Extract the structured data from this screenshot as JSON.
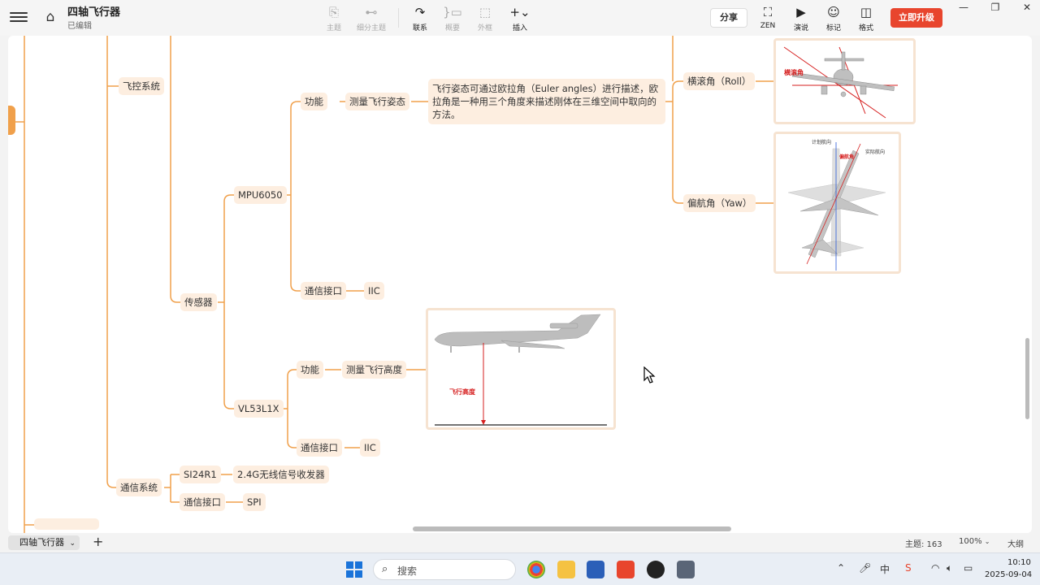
{
  "app": {
    "title": "四轴飞行器",
    "status": "已编辑"
  },
  "toolbar": {
    "tools": [
      {
        "label": "主题",
        "icon": "⎘",
        "enabled": false
      },
      {
        "label": "细分主题",
        "icon": "⊷",
        "enabled": false
      },
      {
        "label": "联系",
        "icon": "↷",
        "enabled": true
      },
      {
        "label": "概要",
        "icon": "}▭",
        "enabled": false
      },
      {
        "label": "外框",
        "icon": "⬚",
        "enabled": false
      },
      {
        "label": "插入",
        "icon": "+⌄",
        "enabled": true
      }
    ],
    "share_label": "分享",
    "view_tools": [
      {
        "label": "ZEN",
        "icon": "⛶"
      },
      {
        "label": "演说",
        "icon": "▶"
      },
      {
        "label": "标记",
        "icon": "☺"
      },
      {
        "label": "格式",
        "icon": "◫"
      }
    ],
    "upgrade_label": "立即升级"
  },
  "mindmap": {
    "flight_control": "飞控系统",
    "sensor": "传感器",
    "mpu6050": "MPU6050",
    "mpu_function": "功能",
    "measure_attitude": "测量飞行姿态",
    "euler_desc": "飞行姿态可通过欧拉角（Euler angles）进行描述，欧拉角是一种用三个角度来描述刚体在三维空间中取向的方法。",
    "roll": "横滚角（Roll）",
    "yaw": "偏航角（Yaw）",
    "roll_img_label": "横滚角",
    "yaw_img_label_planned": "计划航向",
    "yaw_img_label_yaw": "偏航角",
    "yaw_img_label_actual": "实际航向",
    "mpu_interface": "通信接口",
    "mpu_iic": "IIC",
    "vl53l1x": "VL53L1X",
    "vl_function": "功能",
    "measure_height": "测量飞行高度",
    "height_img_label": "飞行高度",
    "vl_interface": "通信接口",
    "vl_iic": "IIC",
    "comm_system": "通信系统",
    "si24r1": "SI24R1",
    "transceiver": "2.4G无线信号收发器",
    "comm_interface": "通信接口",
    "spi": "SPI"
  },
  "sheetbar": {
    "sheet_name": "四轴飞行器",
    "topic_count": "主题: 163",
    "zoom": "100%",
    "outline": "大纲"
  },
  "taskbar": {
    "search_placeholder": "搜索",
    "time": "10:10",
    "date": "2025-09-04"
  },
  "colors": {
    "node_bg": "#fdeee0",
    "line": "#f0a04b",
    "accent": "#e8452d"
  }
}
